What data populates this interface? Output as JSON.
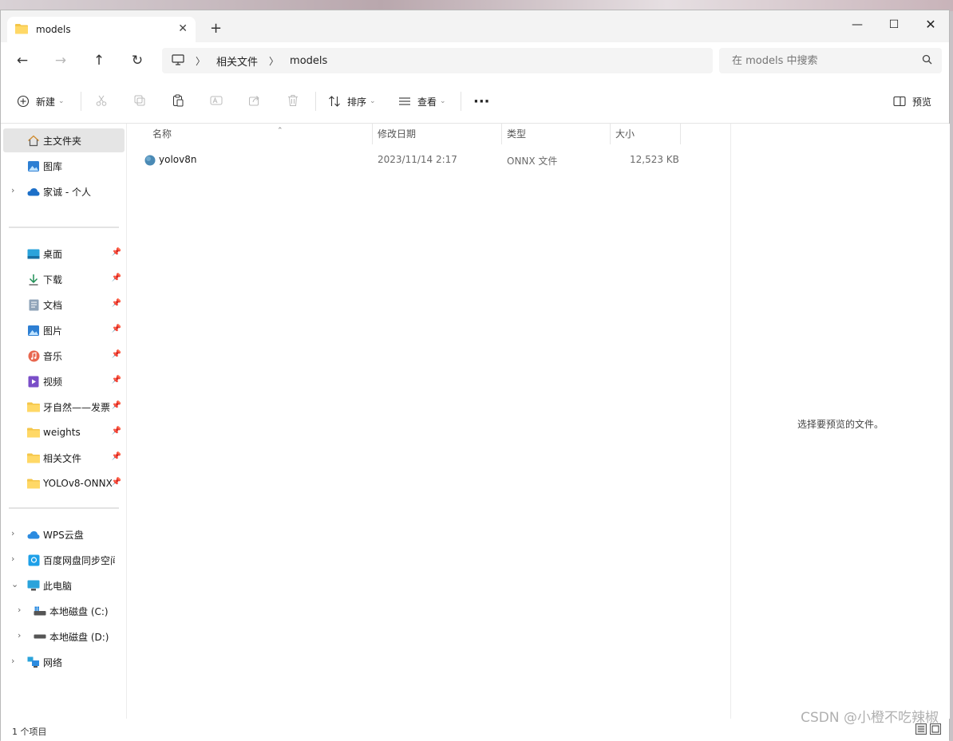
{
  "tab": {
    "title": "models"
  },
  "window": {
    "minimize": "—",
    "maximize": "☐",
    "close": "✕",
    "new_tab": "+",
    "tab_close": "✕"
  },
  "nav": {
    "back": "←",
    "forward": "→",
    "up": "↑",
    "refresh": "↻",
    "breadcrumbs": [
      "相关文件",
      "models"
    ],
    "search_placeholder": "在 models 中搜索"
  },
  "commands": {
    "new": "新建",
    "sort": "排序",
    "view": "查看",
    "more": "···",
    "preview": "预览"
  },
  "sidebar": {
    "top": [
      {
        "label": "主文件夹",
        "icon": "home-icon"
      },
      {
        "label": "图库",
        "icon": "gallery-icon"
      },
      {
        "label": "家诚 - 个人",
        "icon": "cloud-icon"
      }
    ],
    "pinned": [
      {
        "label": "桌面",
        "icon": "desktop-icon"
      },
      {
        "label": "下载",
        "icon": "download-icon"
      },
      {
        "label": "文档",
        "icon": "document-icon"
      },
      {
        "label": "图片",
        "icon": "pictures-icon"
      },
      {
        "label": "音乐",
        "icon": "music-icon"
      },
      {
        "label": "视频",
        "icon": "video-icon"
      },
      {
        "label": "牙自然——发票",
        "icon": "folder-icon"
      },
      {
        "label": "weights",
        "icon": "folder-icon"
      },
      {
        "label": "相关文件",
        "icon": "folder-icon"
      },
      {
        "label": "YOLOv8-ONNX",
        "icon": "folder-icon"
      }
    ],
    "drives": [
      {
        "label": "WPS云盘",
        "icon": "cloud-icon"
      },
      {
        "label": "百度网盘同步空间",
        "icon": "sync-icon"
      },
      {
        "label": "此电脑",
        "icon": "computer-icon"
      },
      {
        "label": "本地磁盘 (C:)",
        "icon": "drive-icon"
      },
      {
        "label": "本地磁盘 (D:)",
        "icon": "drive-icon"
      },
      {
        "label": "网络",
        "icon": "network-icon"
      }
    ]
  },
  "columns": {
    "name": "名称",
    "modified": "修改日期",
    "type": "类型",
    "size": "大小"
  },
  "files": [
    {
      "name": "yolov8n",
      "modified": "2023/11/14 2:17",
      "type": "ONNX 文件",
      "size": "12,523 KB"
    }
  ],
  "preview": {
    "message": "选择要预览的文件。"
  },
  "status": {
    "count": "1 个项目"
  },
  "watermark": "CSDN @小橙不吃辣椒",
  "colors": {
    "accent": "#0067c0",
    "folder": "#f4c64a",
    "selected": "#e5e5e5"
  }
}
